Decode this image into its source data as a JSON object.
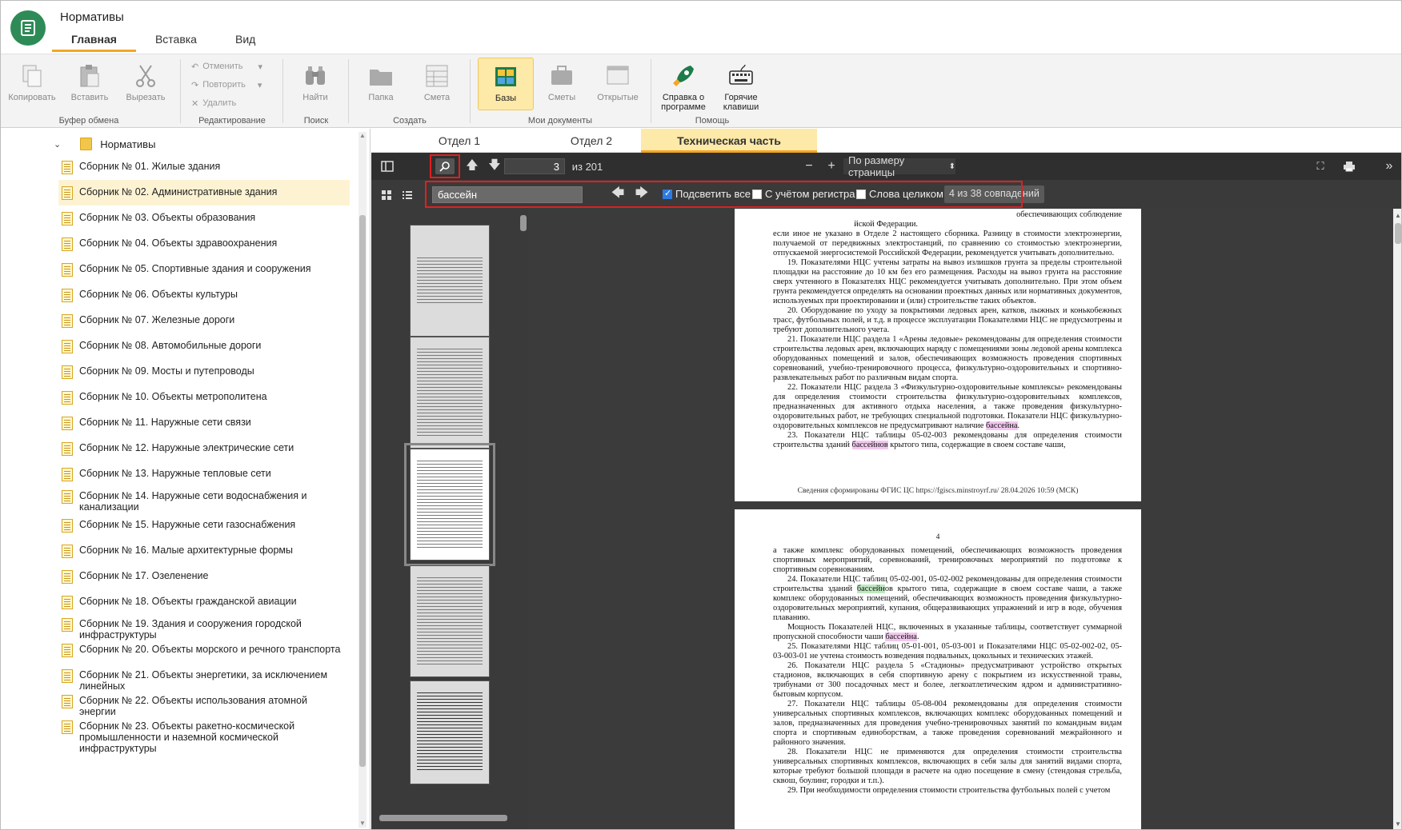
{
  "app": {
    "title": "Нормативы"
  },
  "tabs": [
    "Главная",
    "Вставка",
    "Вид"
  ],
  "ribbon": {
    "clipboard": {
      "label": "Буфер обмена",
      "copy": "Копировать",
      "paste": "Вставить",
      "cut": "Вырезать"
    },
    "edit": {
      "label": "Редактирование",
      "undo": "Отменить",
      "redo": "Повторить",
      "delete": "Удалить"
    },
    "search": {
      "label": "Поиск",
      "find": "Найти"
    },
    "create": {
      "label": "Создать",
      "folder": "Папка",
      "estimate": "Смета"
    },
    "mydocs": {
      "label": "Мои документы",
      "bases": "Базы",
      "estimates": "Сметы",
      "opened": "Открытые"
    },
    "help": {
      "label": "Помощь",
      "about": "Справка о программе",
      "hotkeys": "Горячие клавиши"
    }
  },
  "tree": {
    "root": "Нормативы",
    "items": [
      "Сборник № 01. Жилые здания",
      "Сборник № 02. Административные здания",
      "Сборник № 03. Объекты образования",
      "Сборник № 04. Объекты здравоохранения",
      "Сборник № 05. Спортивные здания и сооружения",
      "Сборник № 06. Объекты культуры",
      "Сборник № 07. Железные дороги",
      "Сборник № 08. Автомобильные дороги",
      "Сборник № 09. Мосты и путепроводы",
      "Сборник № 10. Объекты метрополитена",
      "Сборник № 11. Наружные сети связи",
      "Сборник № 12. Наружные электрические сети",
      "Сборник № 13. Наружные тепловые сети",
      "Сборник № 14. Наружные сети водоснабжения и канализации",
      "Сборник № 15. Наружные сети газоснабжения",
      "Сборник № 16. Малые архитектурные формы",
      "Сборник № 17. Озеленение",
      "Сборник № 18. Объекты гражданской авиации",
      "Сборник № 19. Здания и сооружения городской инфраструктуры",
      "Сборник № 20. Объекты морского и речного транспорта",
      "Сборник № 21. Объекты энергетики, за исключением линейных",
      "Сборник № 22. Объекты использования атомной энергии",
      "Сборник № 23. Объекты ракетно-космической промышленности и наземной космической инфраструктуры"
    ],
    "selected_index": 1
  },
  "doc_tabs": [
    "Отдел 1",
    "Отдел 2",
    "Техническая часть"
  ],
  "viewer": {
    "page_current": "3",
    "page_total": "из 201",
    "zoom": "По размеру страницы",
    "find_value": "бассейн",
    "highlight_all": "Подсветить все",
    "match_case": "С учётом регистра",
    "whole_words": "Слова целиком",
    "match_count": "4 из 38 совпадений"
  },
  "page1": {
    "lines_top": [
      "обеспечивающих соблюдение",
      "йской Федерации."
    ],
    "paragraphs": [
      "если иное не указано в Отделе 2 настоящего сборника. Разницу в стоимости электроэнергии, получаемой от передвижных электростанций, по сравнению со стоимостью электроэнергии, отпускаемой энергосистемой Российской Федерации, рекомендуется учитывать дополнительно.",
      "19. Показателями НЦС учтены затраты на вывоз излишков грунта за пределы строительной площадки на расстояние до 10 км без его размещения. Расходы на вывоз грунта на расстояние сверх учтенного в Показателях НЦС рекомендуется учитывать дополнительно. При этом объем грунта рекомендуется определять на основании проектных данных или нормативных документов, используемых при проектировании и (или) строительстве таких объектов.",
      "20. Оборудование по уходу за покрытиями ледовых арен, катков, лыжных и конькобежных трасс, футбольных полей, и т.д. в процессе эксплуатации Показателями НЦС не предусмотрены и требуют дополнительного учета.",
      "21. Показатели НЦС раздела 1 «Арены ледовые» рекомендованы для определения стоимости строительства ледовых арен, включающих наряду с помещениями зоны ледовой арены комплекса оборудованных помещений и залов, обеспечивающих возможность проведения спортивных соревнований, учебно-тренировочного процесса, физкультурно-оздоровительных и спортивно-развлекательных работ по различным видам спорта.",
      "22. Показатели НЦС раздела 3 «Физкультурно-оздоровительные комплексы» рекомендованы для определения стоимости строительства физкультурно-оздоровительных комплексов, предназначенных для активного отдыха населения, а также проведения физкультурно-оздоровительных работ, не требующих специальной подготовки. Показатели НЦС физкультурно-оздоровительных комплексов не предусматривают наличие ",
      "23. Показатели НЦС таблицы 05-02-003 рекомендованы для определения стоимости строительства зданий "
    ],
    "hl_words": [
      "бассейна",
      "бассейнов"
    ],
    "p23_tail": " крытого типа, содержащие в своем составе чаши,",
    "footer": "Сведения сформированы ФГИС ЦС https://fgiscs.minstroyrf.ru/ 28.04.2026 10:59 (МСК)"
  },
  "page2": {
    "number": "4",
    "p_intro": "а также комплекс оборудованных помещений, обеспечивающих возможность проведения спортивных мероприятий, соревнований, тренировочных мероприятий по подготовке к спортивным соревнованиям.",
    "p24_a": "24. Показатели НЦС таблиц 05-02-001, 05-02-002 рекомендованы для определения стоимости строительства зданий ",
    "p24_hl": "бассейн",
    "p24_b": "ов крытого типа, содержащие в своем составе чаши, а также комплекс оборудованных помещений, обеспечивающих возможность проведения физкультурно-оздоровительных мероприятий, купания, общеразвивающих упражнений и игр в воде, обучения плаванию.",
    "p_power_a": "Мощность Показателей НЦС, включенных в указанные таблицы, соответствует суммарной пропускной способности чаши ",
    "p_power_hl": "бассейна",
    "paragraphs": [
      "25. Показателями НЦС таблиц 05-01-001, 05-03-001 и Показателями НЦС 05-02-002-02, 05-03-003-01 не учтена стоимость возведения подвальных, цокольных и технических этажей.",
      "26. Показатели НЦС раздела 5 «Стадионы» предусматривают устройство открытых стадионов, включающих в себя спортивную арену с покрытием из искусственной травы, трибунами от 300 посадочных мест и более, легкоатлетическим ядром и административно-бытовым корпусом.",
      "27. Показатели НЦС таблицы 05-08-004 рекомендованы для определения стоимости универсальных спортивных комплексов, включающих комплекс оборудованных помещений и залов, предназначенных для проведения учебно-тренировочных занятий по командным видам спорта и спортивным единоборствам, а также проведения соревнований межрайонного и районного значения.",
      "28. Показатели НЦС не применяются для определения стоимости строительства универсальных спортивных комплексов, включающих в себя залы для занятий видами спорта, которые требуют большой площади в расчете на одно посещение в смену (стендовая стрельба, сквош, боулинг, городки и т.п.).",
      "29. При необходимости определения стоимости строительства футбольных полей с учетом"
    ]
  },
  "colors": {
    "accent": "#f5a623",
    "logo": "#2e8b57",
    "highlight": "#f3c8f0",
    "highlight_current": "#bfe8c0",
    "find_box": "#e02020"
  }
}
